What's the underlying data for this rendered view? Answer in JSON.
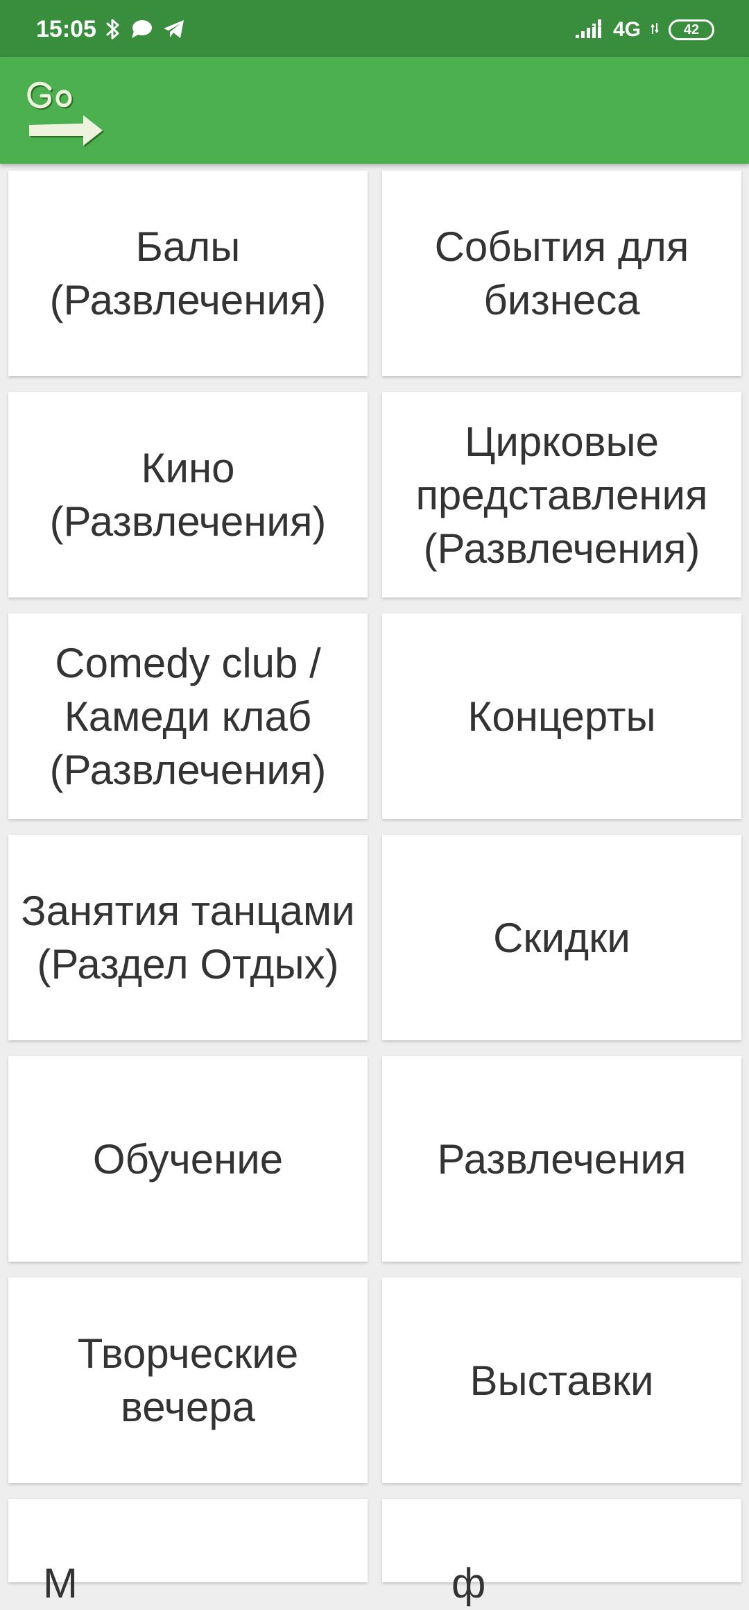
{
  "status_bar": {
    "time": "15:05",
    "network": "4G",
    "battery": "42",
    "icons": [
      "bluetooth-icon",
      "chat-bubble-icon",
      "telegram-icon",
      "signal-icon"
    ]
  },
  "app_bar": {
    "logo_text": "Go",
    "colors": {
      "status_bar": "#388e3c",
      "app_bar": "#4caf50",
      "logo": "#eef3dd"
    }
  },
  "categories": [
    {
      "label": "Балы (Развлечения)"
    },
    {
      "label": "События для бизнеса"
    },
    {
      "label": "Кино (Развлечения)"
    },
    {
      "label": "Цирковые представления (Развлечения)"
    },
    {
      "label": "Comedy club / Камеди клаб (Развлечения)"
    },
    {
      "label": "Концерты"
    },
    {
      "label": "Занятия танцами (Раздел Отдых)"
    },
    {
      "label": "Скидки"
    },
    {
      "label": "Обучение"
    },
    {
      "label": "Развлечения"
    },
    {
      "label": "Творческие вечера"
    },
    {
      "label": "Выставки"
    },
    {
      "label": "М"
    },
    {
      "label": "ф"
    }
  ]
}
